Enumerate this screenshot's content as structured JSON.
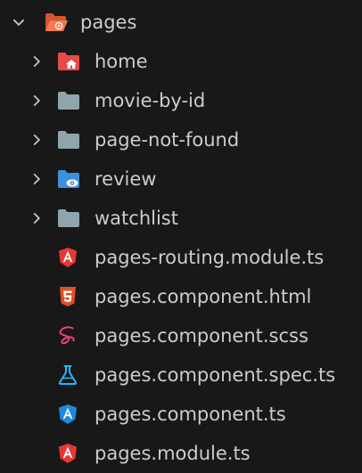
{
  "tree": {
    "root": {
      "label": "pages",
      "expanded": true,
      "icon": "folder-src-open-icon",
      "color": "#e8613c"
    },
    "folders": [
      {
        "label": "home",
        "icon": "folder-home-icon",
        "color": "#ef5350"
      },
      {
        "label": "movie-by-id",
        "icon": "folder-icon",
        "color": "#90a4ae"
      },
      {
        "label": "page-not-found",
        "icon": "folder-icon",
        "color": "#90a4ae"
      },
      {
        "label": "review",
        "icon": "folder-review-icon",
        "color": "#42a5f5"
      },
      {
        "label": "watchlist",
        "icon": "folder-icon",
        "color": "#90a4ae"
      }
    ],
    "files": [
      {
        "label": "pages-routing.module.ts",
        "icon": "angular-routing-icon",
        "color": "#e53935"
      },
      {
        "label": "pages.component.html",
        "icon": "html5-icon",
        "color": "#e44d26"
      },
      {
        "label": "pages.component.scss",
        "icon": "sass-icon",
        "color": "#ec407a"
      },
      {
        "label": "pages.component.spec.ts",
        "icon": "test-flask-icon",
        "color": "#29b6f6"
      },
      {
        "label": "pages.component.ts",
        "icon": "angular-component-icon",
        "color": "#1e88e5"
      },
      {
        "label": "pages.module.ts",
        "icon": "angular-module-icon",
        "color": "#e53935"
      }
    ]
  }
}
